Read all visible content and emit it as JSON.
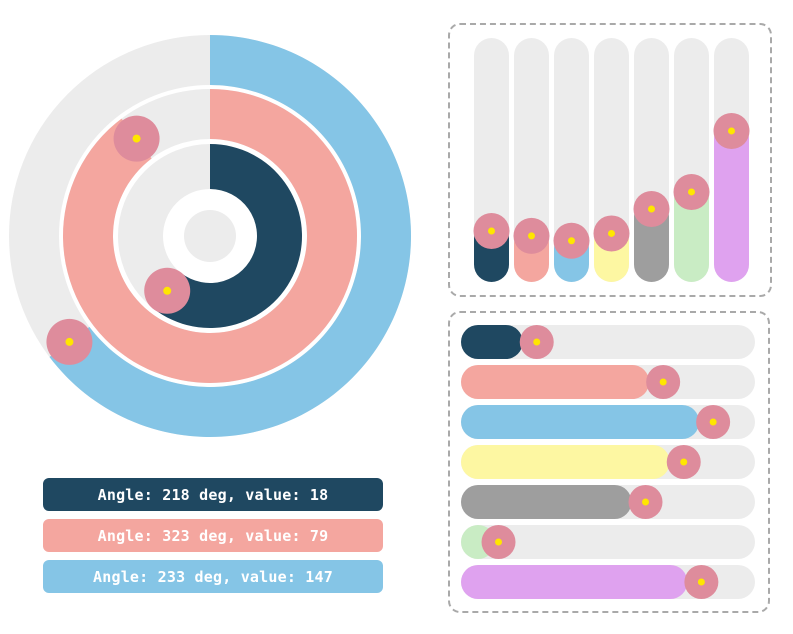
{
  "colors": {
    "track": "#ececec",
    "handle": "#de8c9c",
    "handle_dot": "#ffe600"
  },
  "radial_sliders": [
    {
      "angle_deg": 218,
      "value": 18,
      "color": "#1f4861",
      "label": "Angle: 218 deg, value: 18"
    },
    {
      "angle_deg": 323,
      "value": 79,
      "color": "#f4a69f",
      "label": "Angle: 323 deg, value: 79"
    },
    {
      "angle_deg": 233,
      "value": 147,
      "color": "#85c5e6",
      "label": "Angle: 233 deg, value: 147"
    }
  ],
  "vertical_sliders": [
    {
      "level_pct": 25,
      "color": "#1f4861"
    },
    {
      "level_pct": 23,
      "color": "#f4a69f"
    },
    {
      "level_pct": 21,
      "color": "#85c5e6"
    },
    {
      "level_pct": 24,
      "color": "#fdf7a2"
    },
    {
      "level_pct": 34,
      "color": "#9e9e9e"
    },
    {
      "level_pct": 41,
      "color": "#c9ecc4"
    },
    {
      "level_pct": 66,
      "color": "#dfa2ef"
    }
  ],
  "horizontal_sliders": [
    {
      "level_pct": 21,
      "color": "#1f4861"
    },
    {
      "level_pct": 64,
      "color": "#f4a69f"
    },
    {
      "level_pct": 81,
      "color": "#85c5e6"
    },
    {
      "level_pct": 71,
      "color": "#fdf7a2"
    },
    {
      "level_pct": 58,
      "color": "#9e9e9e"
    },
    {
      "level_pct": 8,
      "color": "#c9ecc4"
    },
    {
      "level_pct": 77,
      "color": "#dfa2ef"
    }
  ]
}
